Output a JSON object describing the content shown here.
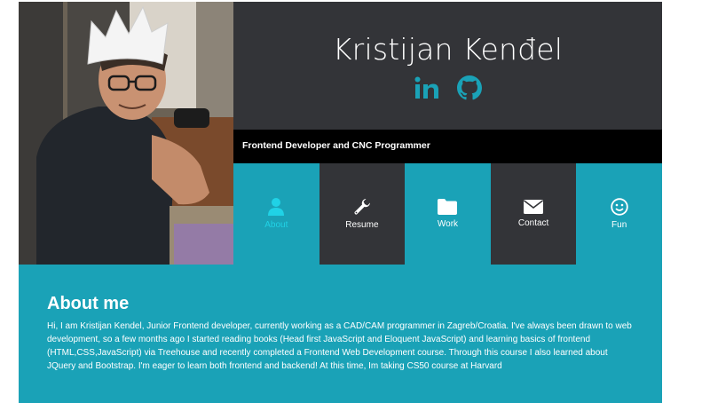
{
  "header": {
    "name": "Kristijan Kenđel",
    "tagline": "Frontend Developer and CNC Programmer"
  },
  "social": [
    {
      "icon": "linkedin-icon",
      "label": "in"
    },
    {
      "icon": "github-icon"
    }
  ],
  "nav": {
    "items": [
      {
        "label": "About",
        "icon": "user-icon",
        "active": true
      },
      {
        "label": "Resume",
        "icon": "wrench-icon"
      },
      {
        "label": "Work",
        "icon": "folder-icon"
      },
      {
        "label": "Contact",
        "icon": "envelope-icon"
      },
      {
        "label": "Fun",
        "icon": "smile-icon"
      }
    ]
  },
  "about": {
    "title": "About me",
    "text": "Hi, I am Kristijan Kendel, Junior Frontend developer, currently working as a CAD/CAM programmer in Zagreb/Croatia. I've always been drawn to web development, so a few months ago I started reading books (Head first JavaScript and Eloquent JavaScript) and learning basics of frontend (HTML,CSS,JavaScript) via Treehouse and recently completed a Frontend Web Development course. Through this course I also learned about JQuery and Bootstrap. I'm eager to learn both frontend and backend! At this time, Im taking CS50 course at Harvard"
  },
  "colors": {
    "dark": "#333438",
    "teal": "#1aa2b7",
    "active": "#20d2e6",
    "black": "#000000",
    "white": "#ffffff"
  }
}
